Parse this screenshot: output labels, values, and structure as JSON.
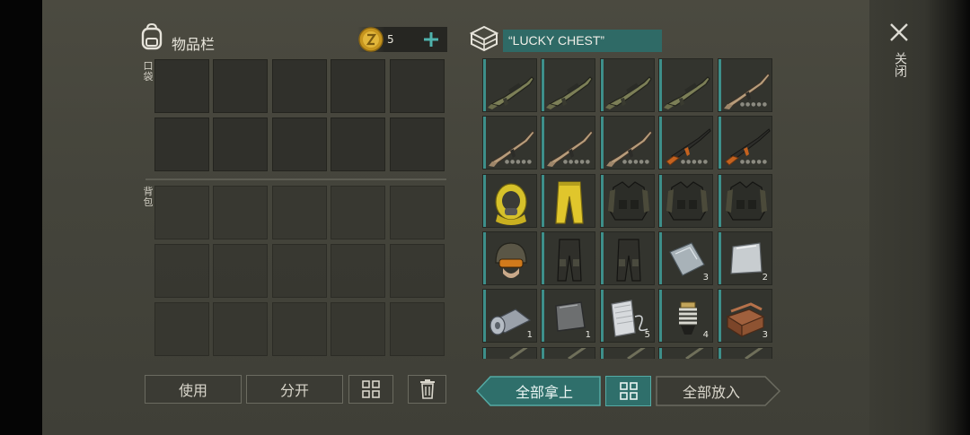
{
  "inventory": {
    "title": "物品栏",
    "coins": "5",
    "pockets_label": "口袋",
    "backpack_label": "背包",
    "use_label": "使用",
    "split_label": "分开"
  },
  "chest": {
    "title": "“LUCKY CHEST”",
    "take_all_label": "全部拿上",
    "put_all_label": "全部放入",
    "items": [
      {
        "icon": "assault-rifle-green",
        "count": ""
      },
      {
        "icon": "assault-rifle-green",
        "count": ""
      },
      {
        "icon": "assault-rifle-green",
        "count": ""
      },
      {
        "icon": "assault-rifle-green",
        "count": ""
      },
      {
        "icon": "tan-rifle",
        "count": ""
      },
      {
        "icon": "tan-rifle",
        "count": ""
      },
      {
        "icon": "tan-rifle",
        "count": ""
      },
      {
        "icon": "tan-rifle",
        "count": ""
      },
      {
        "icon": "orange-stock-rifle",
        "count": ""
      },
      {
        "icon": "orange-stock-rifle",
        "count": ""
      },
      {
        "icon": "hazmat-gas-mask",
        "count": ""
      },
      {
        "icon": "hazmat-pants",
        "count": ""
      },
      {
        "icon": "tactical-vest",
        "count": ""
      },
      {
        "icon": "tactical-vest",
        "count": ""
      },
      {
        "icon": "tactical-vest",
        "count": ""
      },
      {
        "icon": "combat-helmet",
        "count": ""
      },
      {
        "icon": "tactical-pants",
        "count": ""
      },
      {
        "icon": "tactical-pants",
        "count": ""
      },
      {
        "icon": "steel-plate",
        "count": "3"
      },
      {
        "icon": "aluminum-plate",
        "count": "2"
      },
      {
        "icon": "fabric-roll",
        "count": "1"
      },
      {
        "icon": "metal-plate",
        "count": "1"
      },
      {
        "icon": "foil-wire",
        "count": "5"
      },
      {
        "icon": "spring-part",
        "count": "4"
      },
      {
        "icon": "bricks",
        "count": "3"
      }
    ]
  },
  "close": {
    "label": "关闭"
  },
  "colors": {
    "accent": "#3d8f8a",
    "accent_dark": "#2c6b68",
    "coin": "#d4a52a"
  }
}
